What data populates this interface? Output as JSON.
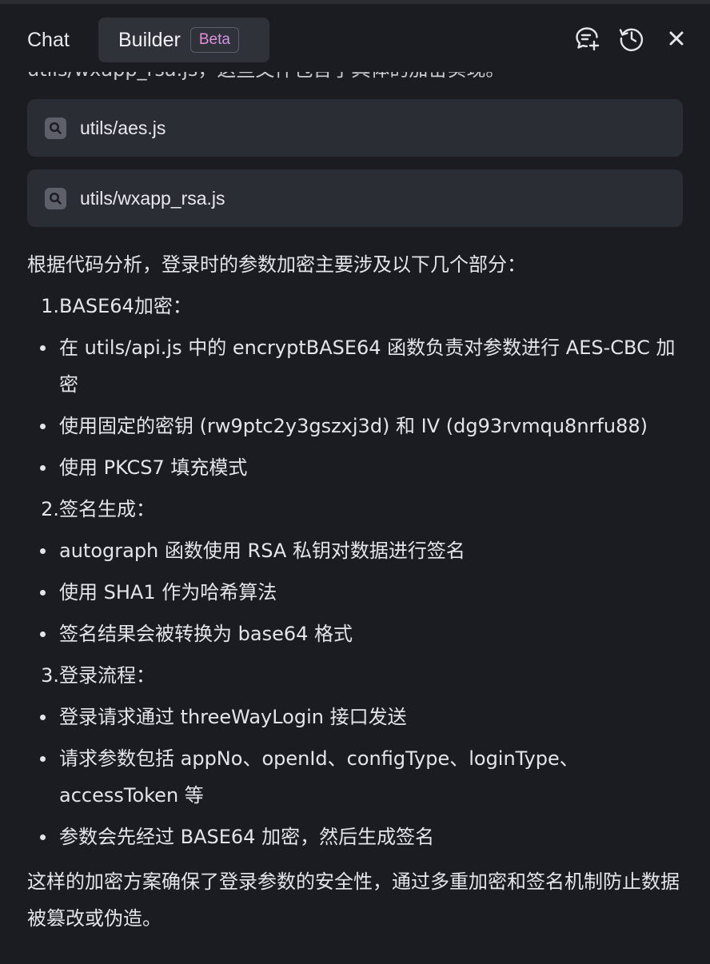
{
  "header": {
    "tab_chat": "Chat",
    "tab_builder": "Builder",
    "badge": "Beta",
    "icons": [
      "new-chat-icon",
      "history-icon",
      "close-icon"
    ]
  },
  "truncated_line": "utils/wxapp_rsa.js，这些文件包含了具体的加密实现。",
  "files": [
    {
      "name": "utils/aes.js"
    },
    {
      "name": "utils/wxapp_rsa.js"
    }
  ],
  "content": {
    "intro": "根据代码分析，登录时的参数加密主要涉及以下几个部分：",
    "sections": [
      {
        "number": "1.",
        "title": "BASE64加密：",
        "bullets": [
          "在 utils/api.js 中的 encryptBASE64 函数负责对参数进行 AES-CBC 加密",
          "使用固定的密钥 (rw9ptc2y3gszxj3d) 和 IV (dg93rvmqu8nrfu88)",
          "使用 PKCS7 填充模式"
        ]
      },
      {
        "number": "2.",
        "title": "签名生成：",
        "bullets": [
          "autograph 函数使用 RSA 私钥对数据进行签名",
          "使用 SHA1 作为哈希算法",
          "签名结果会被转换为 base64 格式"
        ]
      },
      {
        "number": "3.",
        "title": "登录流程：",
        "bullets": [
          "登录请求通过 threeWayLogin 接口发送",
          "请求参数包括 appNo、openId、configType、loginType、accessToken 等",
          "参数会先经过 BASE64 加密，然后生成签名"
        ]
      }
    ],
    "conclusion": "这样的加密方案确保了登录参数的安全性，通过多重加密和签名机制防止数据被篡改或伪造。"
  }
}
